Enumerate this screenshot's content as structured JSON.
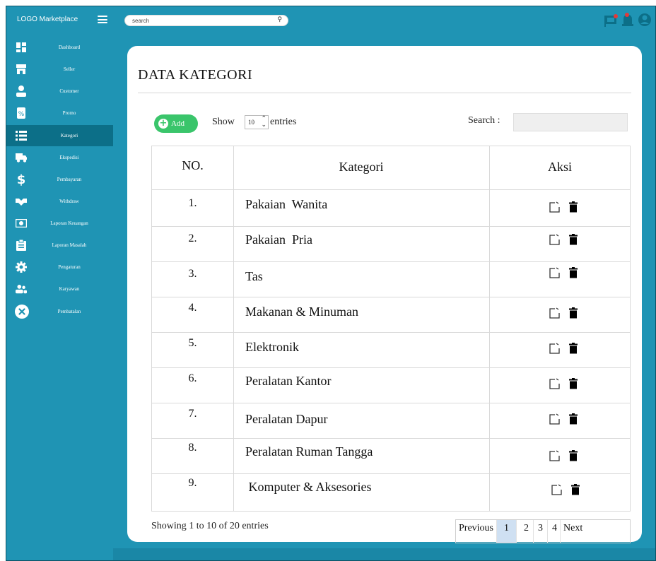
{
  "topbar": {
    "logo": "LOGO Marketplace",
    "search_value": "search",
    "icons": [
      "flag-icon",
      "bell-icon",
      "user-icon"
    ]
  },
  "sidebar": {
    "items": [
      {
        "label": "Dashboard",
        "icon": "dashboard-icon"
      },
      {
        "label": "Seller",
        "icon": "store-icon"
      },
      {
        "label": "Customer",
        "icon": "person-icon"
      },
      {
        "label": "Promo",
        "icon": "promo-icon"
      },
      {
        "label": "Kategori",
        "icon": "list-icon",
        "active": true
      },
      {
        "label": "Ekspedisi",
        "icon": "truck-icon"
      },
      {
        "label": "Pembayaran",
        "icon": "dollar-icon"
      },
      {
        "label": "Withdraw",
        "icon": "handshake-icon"
      },
      {
        "label": "Laporan Keuangan",
        "icon": "money-icon"
      },
      {
        "label": "Laporan Masalah",
        "icon": "clipboard-icon"
      },
      {
        "label": "Pengaturan",
        "icon": "gear-icon"
      },
      {
        "label": "Karyawan",
        "icon": "people-icon"
      },
      {
        "label": "Pembatalan",
        "icon": "cancel-icon"
      }
    ]
  },
  "main": {
    "title": "DATA KATEGORI",
    "add_label": "Add",
    "show_label": "Show",
    "entries_value": "10",
    "entries_label": "entries",
    "search_label": "Search :",
    "columns": [
      "NO.",
      "Kategori",
      "Aksi"
    ],
    "rows": [
      {
        "no": "1.",
        "kategori": "Pakaian  Wanita"
      },
      {
        "no": "2.",
        "kategori": "Pakaian  Pria"
      },
      {
        "no": "3.",
        "kategori": "Tas"
      },
      {
        "no": "4.",
        "kategori": "Makanan & Minuman"
      },
      {
        "no": "5.",
        "kategori": "Elektronik"
      },
      {
        "no": "6.",
        "kategori": "Peralatan Kantor"
      },
      {
        "no": "7.",
        "kategori": "Peralatan Dapur"
      },
      {
        "no": "8.",
        "kategori": "Peralatan Ruman Tangga"
      },
      {
        "no": "9.",
        "kategori": " Komputer & Aksesories"
      }
    ],
    "showing_text": "Showing 1 to 10 of 20 entries",
    "pagination": {
      "previous": "Previous",
      "pages": [
        "1",
        "2",
        "3",
        "4"
      ],
      "active_page": "1",
      "next": "Next"
    }
  },
  "colors": {
    "sidebar_bg": "#1f94b4",
    "sidebar_active": "#0c6f88",
    "add_button": "#3ac56b",
    "active_page": "#cfe0f2",
    "notification_dot": "#e23a3a"
  }
}
